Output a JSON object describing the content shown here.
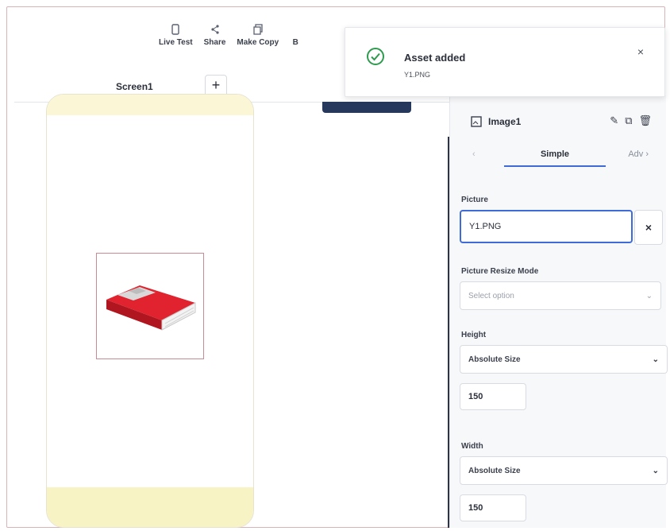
{
  "toolbar": {
    "live_test": "Live Test",
    "share": "Share",
    "make_copy": "Make Copy",
    "truncated": "B"
  },
  "screen_tab": {
    "label": "Screen1",
    "add": "+"
  },
  "toast": {
    "title": "Asset added",
    "subtitle": "Y1.PNG",
    "close": "×",
    "icon": "check-circle-icon",
    "accent": "#2e9b4e"
  },
  "panel": {
    "component_name": "Image1",
    "tabs": {
      "prev": "‹",
      "simple": "Simple",
      "advanced": "Adv ›"
    },
    "picture": {
      "label": "Picture",
      "value": "Y1.PNG",
      "clear": "×"
    },
    "resize_mode": {
      "label": "Picture Resize Mode",
      "placeholder": "Select option"
    },
    "height": {
      "label": "Height",
      "mode": "Absolute Size",
      "value": "150"
    },
    "width": {
      "label": "Width",
      "mode": "Absolute Size",
      "value": "150"
    }
  },
  "colors": {
    "accent_blue": "#3f6bd8",
    "dark_button": "#26385b",
    "book_red": "#d2202a",
    "phone_yellow": "#fbf7d6"
  }
}
